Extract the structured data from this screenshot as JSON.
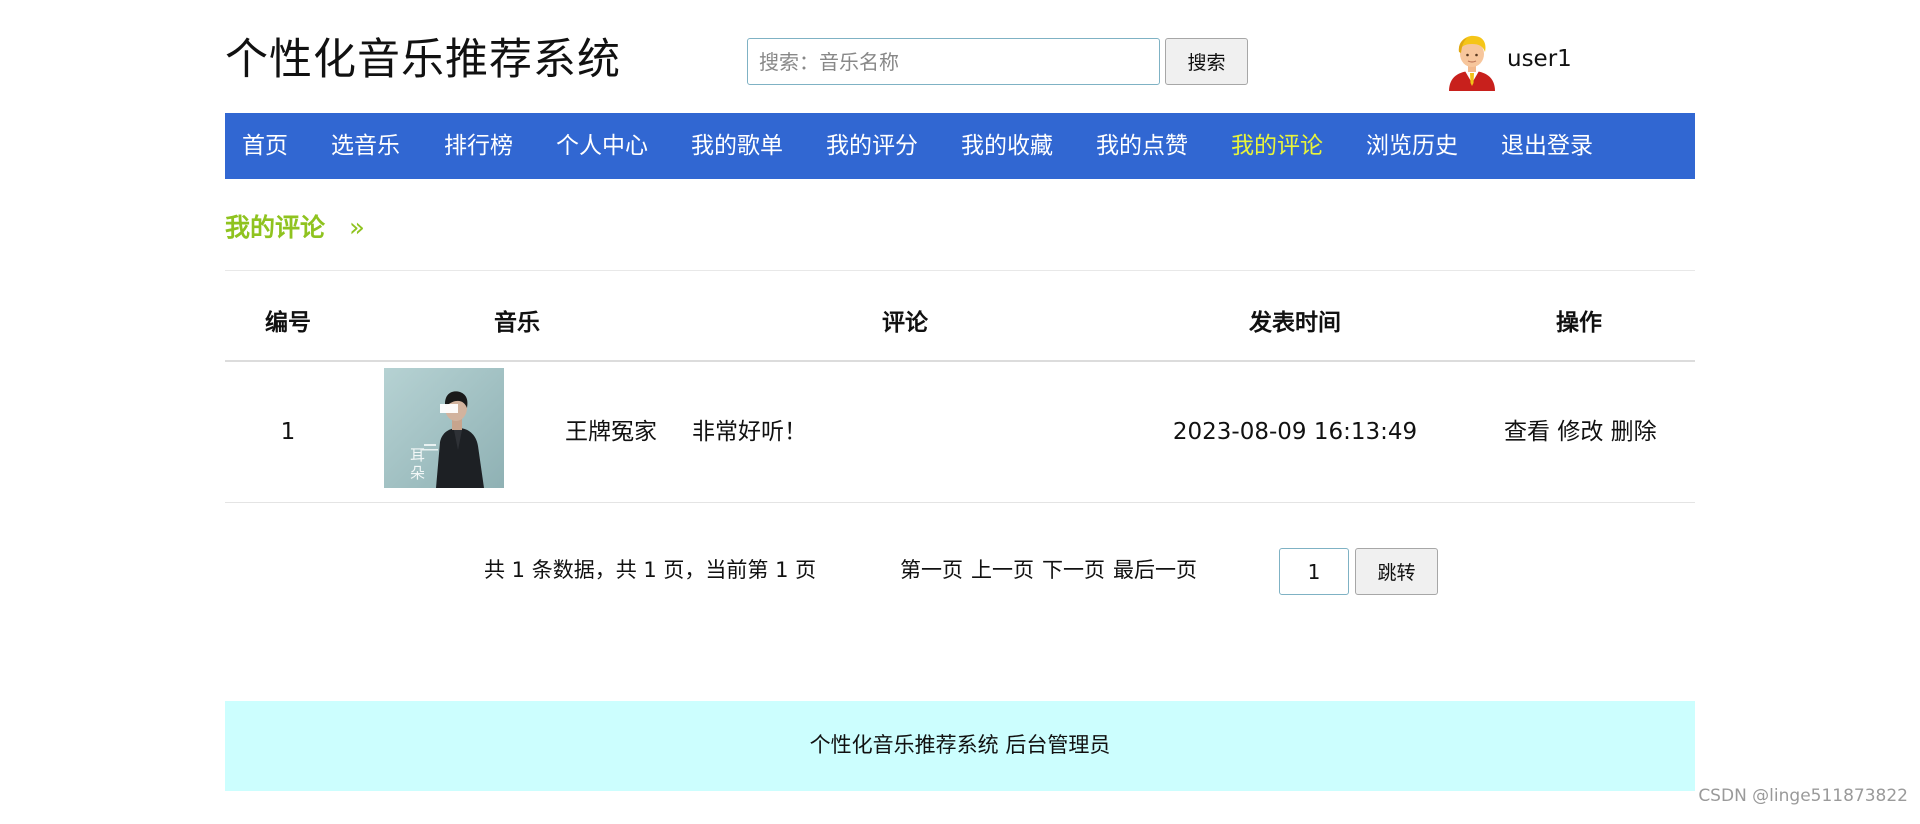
{
  "header": {
    "site_title": "个性化音乐推荐系统",
    "search_placeholder": "搜索：音乐名称",
    "search_button": "搜索",
    "username": "user1"
  },
  "nav": {
    "items": [
      {
        "label": "首页"
      },
      {
        "label": "选音乐"
      },
      {
        "label": "排行榜"
      },
      {
        "label": "个人中心"
      },
      {
        "label": "我的歌单"
      },
      {
        "label": "我的评分"
      },
      {
        "label": "我的收藏"
      },
      {
        "label": "我的点赞"
      },
      {
        "label": "我的评论"
      },
      {
        "label": "浏览历史"
      },
      {
        "label": "退出登录"
      }
    ],
    "active_index": 8,
    "active_color": "#e8f43a",
    "bar_color": "#3167d2"
  },
  "breadcrumb": {
    "title": "我的评论",
    "arrow": "»",
    "color": "#8fc31f"
  },
  "table": {
    "headers": {
      "id": "编号",
      "music": "音乐",
      "comment": "评论",
      "time": "发表时间",
      "ops": "操作"
    },
    "rows": [
      {
        "id": "1",
        "cover_text": "耳朵",
        "music_name": "王牌冤家",
        "comment": "非常好听！",
        "time": "2023-08-09 16:13:49",
        "actions": {
          "view": "查看",
          "edit": "修改",
          "delete": "删除"
        }
      }
    ]
  },
  "pagination": {
    "summary": "共 1 条数据，共 1 页，当前第 1 页",
    "first": "第一页",
    "prev": "上一页",
    "next": "下一页",
    "last": "最后一页",
    "page_input": "1",
    "go_button": "跳转"
  },
  "footer": {
    "text": "个性化音乐推荐系统 后台管理员",
    "bg_color": "#ccfefe"
  },
  "watermark": "CSDN @linge511873822"
}
